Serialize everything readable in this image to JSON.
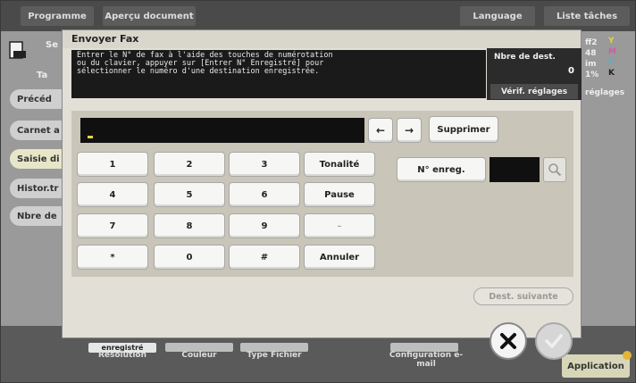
{
  "topbar": {
    "tabs": [
      "Programme",
      "Aperçu document",
      "Language",
      "Liste tâches"
    ]
  },
  "background": {
    "left_items": [
      "Se",
      "Ta",
      "Précéd",
      "Carnet a",
      "Saisie di",
      "Histor.tr",
      "Nbre de"
    ],
    "right_texts": [
      "ff2",
      "48",
      "im",
      "1%",
      "réglages"
    ],
    "cmyk": [
      "Y",
      "M",
      "C",
      "K"
    ],
    "bottom_tabs": [
      "Résolution",
      "Couleur",
      "Type Fichier",
      "Configuration e-mail"
    ],
    "bottom_chip_text": "enregistré",
    "application_label": "Application"
  },
  "dialog": {
    "title": "Envoyer Fax",
    "instruction_line1": "Entrer le N° de fax à l'aide des touches de numérotation",
    "instruction_line2": "ou du clavier, appuyer sur [Entrer N° Enregistré] pour",
    "instruction_line3": "sélectionner le numéro d'une destination enregistrée.",
    "dest_label": "Nbre de dest.",
    "dest_count": "0",
    "verif_label": "Vérif. réglages",
    "entry_value": "",
    "arrow_left": "←",
    "arrow_right": "→",
    "delete_label": "Supprimer",
    "keypad": [
      [
        "1",
        "2",
        "3",
        "Tonalité"
      ],
      [
        "4",
        "5",
        "6",
        "Pause"
      ],
      [
        "7",
        "8",
        "9",
        "–"
      ],
      [
        "*",
        "0",
        "#",
        "Annuler"
      ]
    ],
    "reg_no_label": "N° enreg.",
    "next_dest_label": "Dest. suivante"
  },
  "colors": {
    "close_x": "#111111",
    "ok_check": "#f0f0f0",
    "dest_box": "#2b2b2b",
    "caret": "#e8d24a"
  },
  "icons": {
    "close": "close-icon",
    "ok": "checkmark-icon",
    "search": "magnifier-icon",
    "scan": "document-scan-icon"
  }
}
